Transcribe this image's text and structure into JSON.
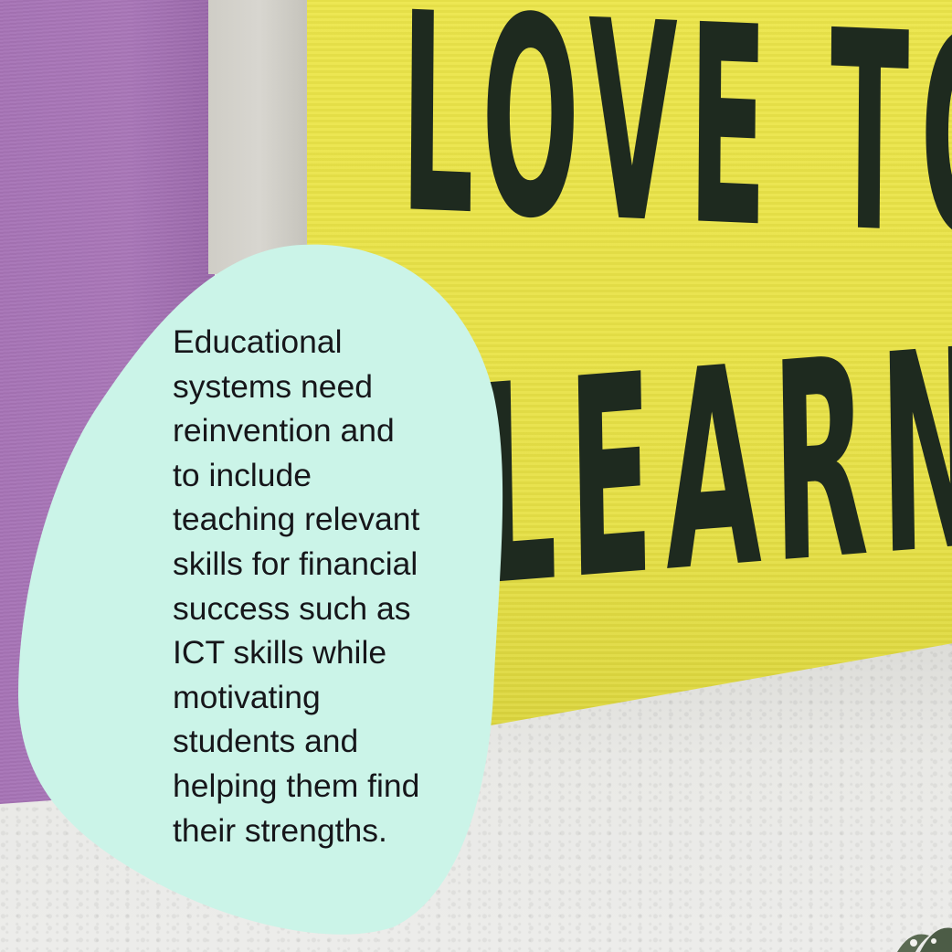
{
  "sign": {
    "line1": "LOVE TO",
    "line2": "LEARN"
  },
  "caption": {
    "lines": [
      "Educational",
      "systems need",
      "reinvention and",
      "to include",
      "teaching relevant",
      "skills for financial",
      "success such as",
      "ICT skills while",
      "motivating",
      "students and",
      "helping them find",
      "their strengths."
    ]
  },
  "colors": {
    "blob": "#cbf4e8",
    "sign_yellow": "#e9e347",
    "board_purple": "#a876b7",
    "lettering": "#1e2a1f"
  }
}
